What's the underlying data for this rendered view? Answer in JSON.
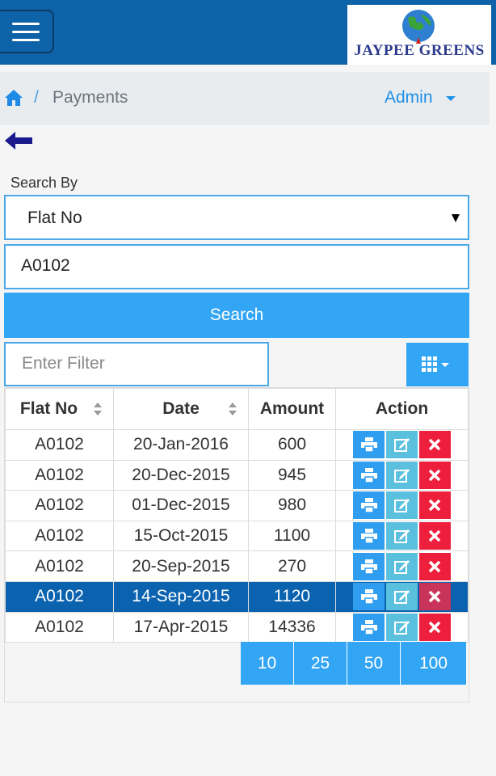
{
  "header": {
    "logo_text": "JAYPEE GREENS",
    "colors": {
      "topbar": "#0e63a8",
      "accent": "#33a5f5",
      "danger": "#ee1f3d",
      "edit": "#5bc0de"
    }
  },
  "breadcrumb": {
    "separator": "/",
    "page": "Payments",
    "user_menu": "Admin"
  },
  "search": {
    "label": "Search By",
    "selected": "Flat No",
    "value": "A0102",
    "button": "Search",
    "filter_placeholder": "Enter Filter"
  },
  "table": {
    "headers": [
      "Flat No",
      "Date",
      "Amount",
      "Action"
    ],
    "rows": [
      {
        "flat": "A0102",
        "date": "20-Jan-2016",
        "amount": "600"
      },
      {
        "flat": "A0102",
        "date": "20-Dec-2015",
        "amount": "945"
      },
      {
        "flat": "A0102",
        "date": "01-Dec-2015",
        "amount": "980"
      },
      {
        "flat": "A0102",
        "date": "15-Oct-2015",
        "amount": "1100"
      },
      {
        "flat": "A0102",
        "date": "20-Sep-2015",
        "amount": "270"
      },
      {
        "flat": "A0102",
        "date": "14-Sep-2015",
        "amount": "1120"
      },
      {
        "flat": "A0102",
        "date": "17-Apr-2015",
        "amount": "14336"
      }
    ],
    "selected_row": 5
  },
  "pagination": [
    "10",
    "25",
    "50",
    "100"
  ],
  "icons": [
    "menu-icon",
    "home-icon",
    "back-arrow-icon",
    "columns-grid-icon",
    "print-icon",
    "edit-icon",
    "delete-icon",
    "sort-icon"
  ]
}
